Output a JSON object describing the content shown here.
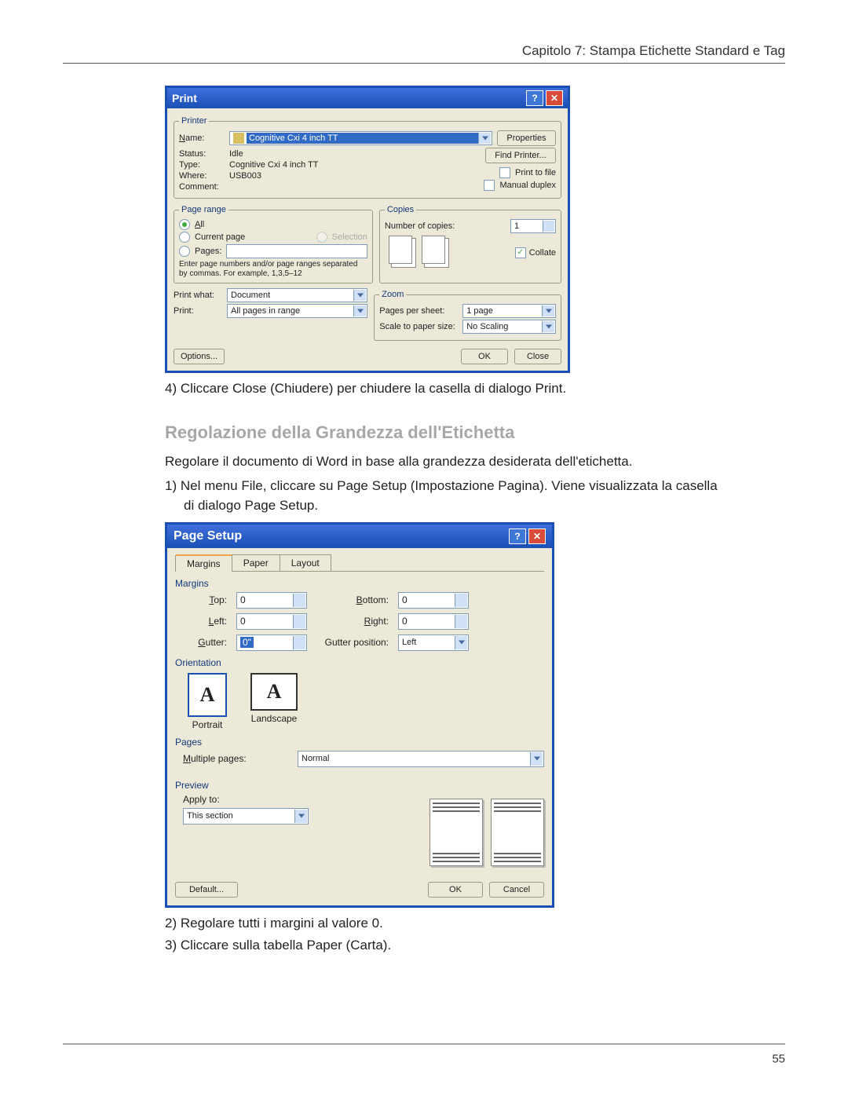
{
  "header": {
    "chapter": "Capitolo 7: Stampa Etichette Standard e Tag"
  },
  "footer": {
    "pageNum": "55"
  },
  "step4": "4)   Cliccare Close (Chiudere) per chiudere la casella di dialogo Print.",
  "sectionHeading": "Regolazione della Grandezza dell'Etichetta",
  "intro": "Regolare il documento di Word in base alla grandezza desiderata dell'etichetta.",
  "step1": "1)   Nel menu File, cliccare su Page Setup (Impostazione Pagina). Viene visualizzata la casella di dialogo Page Setup.",
  "step2": "2)   Regolare tutti i margini al valore 0.",
  "step3b": "3)   Cliccare sulla tabella Paper (Carta).",
  "printDlg": {
    "title": "Print",
    "printer": {
      "legend": "Printer",
      "nameLabel": "Name:",
      "nameValue": "Cognitive Cxi 4 inch TT",
      "statusLabel": "Status:",
      "statusValue": "Idle",
      "typeLabel": "Type:",
      "typeValue": "Cognitive Cxi 4 inch TT",
      "whereLabel": "Where:",
      "whereValue": "USB003",
      "commentLabel": "Comment:",
      "propertiesBtn": "Properties",
      "findPrinterBtn": "Find Printer...",
      "printToFile": "Print to file",
      "manualDuplex": "Manual duplex"
    },
    "pageRange": {
      "legend": "Page range",
      "all": "All",
      "current": "Current page",
      "selection": "Selection",
      "pages": "Pages:",
      "hint": "Enter page numbers and/or page ranges separated by commas. For example, 1,3,5–12"
    },
    "copies": {
      "legend": "Copies",
      "numLabel": "Number of copies:",
      "numValue": "1",
      "collate": "Collate"
    },
    "printWhatLabel": "Print what:",
    "printWhatValue": "Document",
    "printLabel": "Print:",
    "printValue": "All pages in range",
    "zoom": {
      "legend": "Zoom",
      "ppsLabel": "Pages per sheet:",
      "ppsValue": "1 page",
      "scaleLabel": "Scale to paper size:",
      "scaleValue": "No Scaling"
    },
    "optionsBtn": "Options...",
    "okBtn": "OK",
    "closeBtn": "Close"
  },
  "pageSetup": {
    "title": "Page Setup",
    "tabs": {
      "margins": "Margins",
      "paper": "Paper",
      "layout": "Layout"
    },
    "marginsLegend": "Margins",
    "topLbl": "Top:",
    "topVal": "0",
    "bottomLbl": "Bottom:",
    "bottomVal": "0",
    "leftLbl": "Left:",
    "leftVal": "0",
    "rightLbl": "Right:",
    "rightVal": "0",
    "gutterLbl": "Gutter:",
    "gutterVal": "0\"",
    "gutterPosLbl": "Gutter position:",
    "gutterPosVal": "Left",
    "orientLegend": "Orientation",
    "portrait": "Portrait",
    "landscape": "Landscape",
    "pagesLegend": "Pages",
    "multiPagesLbl": "Multiple pages:",
    "multiPagesVal": "Normal",
    "previewLegend": "Preview",
    "applyToLbl": "Apply to:",
    "applyToVal": "This section",
    "defaultBtn": "Default...",
    "okBtn": "OK",
    "cancelBtn": "Cancel"
  }
}
